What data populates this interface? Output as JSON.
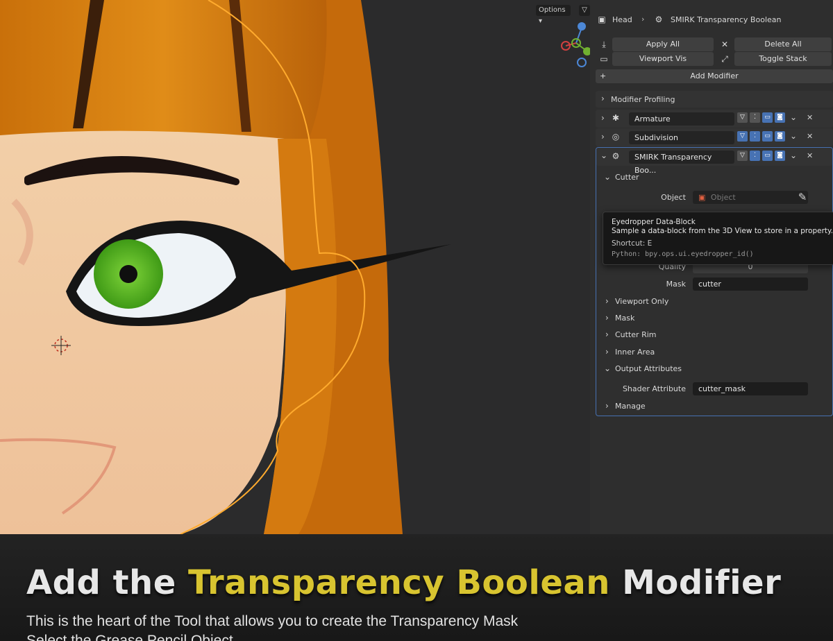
{
  "viewport": {
    "options_label": "Options"
  },
  "panel": {
    "breadcrumb": {
      "object": "Head",
      "modifier": "SMIRK Transparency Boolean"
    },
    "toolbar": {
      "apply_all": "Apply All",
      "delete_all": "Delete All",
      "viewport_vis": "Viewport Vis",
      "toggle_stack": "Toggle Stack",
      "add_modifier": "Add Modifier"
    },
    "modifier_profiling": "Modifier Profiling",
    "modifiers": [
      {
        "name": "Armature"
      },
      {
        "name": "Subdivision"
      },
      {
        "name": "SMIRK Transparency Boo..."
      }
    ],
    "cutter": {
      "section": "Cutter",
      "object_label": "Object",
      "object_placeholder": "Object",
      "quality_label": "Quality",
      "quality_value": "0",
      "mask_label": "Mask",
      "mask_value": "cutter"
    },
    "sections": {
      "viewport_only": "Viewport Only",
      "mask": "Mask",
      "cutter_rim": "Cutter Rim",
      "inner_area": "Inner Area",
      "output_attributes": "Output Attributes",
      "manage": "Manage"
    },
    "output": {
      "shader_attribute_label": "Shader Attribute",
      "shader_attribute_value": "cutter_mask"
    }
  },
  "tooltip": {
    "title": "Eyedropper Data-Block",
    "description": "Sample a data-block from the 3D View to store in a property.",
    "shortcut": "Shortcut: E",
    "python": "Python: bpy.ops.ui.eyedropper_id()"
  },
  "caption": {
    "title_part1": "Add the ",
    "title_highlight": "Transparency Boolean",
    "title_part2": " Modifier",
    "subtitle_line1": "This is the heart of the Tool that allows you to create the Transparency Mask",
    "subtitle_line2": "Select the Grease Pencil Object"
  },
  "colors": {
    "accent_blue": "#4772b3",
    "highlight_yellow": "#d8c430",
    "hair_orange": "#d8820e",
    "eye_green": "#4aa41c"
  }
}
